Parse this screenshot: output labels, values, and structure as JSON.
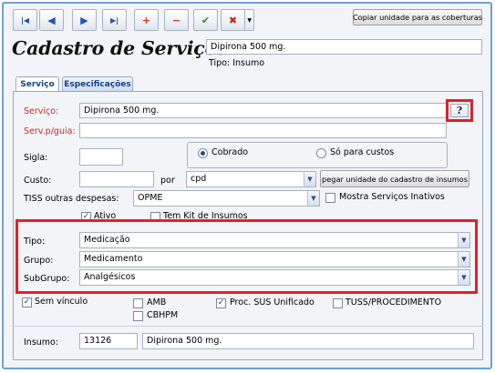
{
  "toolbar": {
    "buttons": [
      {
        "name": "first-record",
        "glyph": "|◀",
        "color": "#2254b0"
      },
      {
        "name": "previous-record",
        "glyph": "◀",
        "color": "#2254b0"
      },
      {
        "name": "next-record",
        "glyph": "▶",
        "color": "#2254b0"
      },
      {
        "name": "last-record",
        "glyph": "▶|",
        "color": "#2254b0"
      },
      {
        "name": "add-record",
        "glyph": "+",
        "color": "#d63a1a"
      },
      {
        "name": "delete-record",
        "glyph": "−",
        "color": "#d63a1a"
      },
      {
        "name": "confirm",
        "glyph": "✔",
        "color": "#2e8b2e"
      },
      {
        "name": "cancel",
        "glyph": "✖",
        "color": "#d41c1c"
      }
    ],
    "copy_label": "Copiar unidade para as coberturas"
  },
  "header": {
    "title": "Cadastro de Serviços",
    "current_name": "Dipirona 500 mg.",
    "type_line": "Tipo: Insumo"
  },
  "tabs": [
    {
      "label": "Serviço",
      "active": true
    },
    {
      "label": "Especificações",
      "active": false
    }
  ],
  "form": {
    "servico_label": "Serviço:",
    "servico_value": "Dipirona 500 mg.",
    "help_glyph": "?",
    "servguia_label": "Serv.p/guia:",
    "servguia_value": "",
    "sigla_label": "Sigla:",
    "sigla_value": "",
    "radio_cobrado": "Cobrado",
    "radio_custos": "Só para custos",
    "custo_label": "Custo:",
    "custo_value": "",
    "por_label": "por",
    "unit_value": "cpd",
    "pegar_label": "pegar unidade do cadastro de insumos",
    "tiss_label": "TISS outras despesas:",
    "tiss_value": "OPME",
    "mostra_inativos": "Mostra Serviços Inativos",
    "ativo_label": "Ativo",
    "kit_label": "Tem Kit de Insumos",
    "tipo_label": "Tipo:",
    "tipo_value": "Medicação",
    "grupo_label": "Grupo:",
    "grupo_value": "Medicamento",
    "subgrupo_label": "SubGrupo:",
    "subgrupo_value": "Analgésicos",
    "sem_vinculo": "Sem vínculo",
    "amb": "AMB",
    "cbhpm": "CBHPM",
    "proc_sus": "Proc. SUS Unificado",
    "tuss": "TUSS/PROCEDIMENTO",
    "insumo_label": "Insumo:",
    "insumo_code": "13126",
    "insumo_name": "Dipirona 500 mg."
  },
  "checkbox_states": {
    "mostra_inativos": false,
    "ativo": true,
    "kit": false,
    "sem_vinculo": true,
    "amb": false,
    "cbhpm": false,
    "proc_sus": true,
    "tuss": false
  },
  "highlight_color": "#e0202a"
}
